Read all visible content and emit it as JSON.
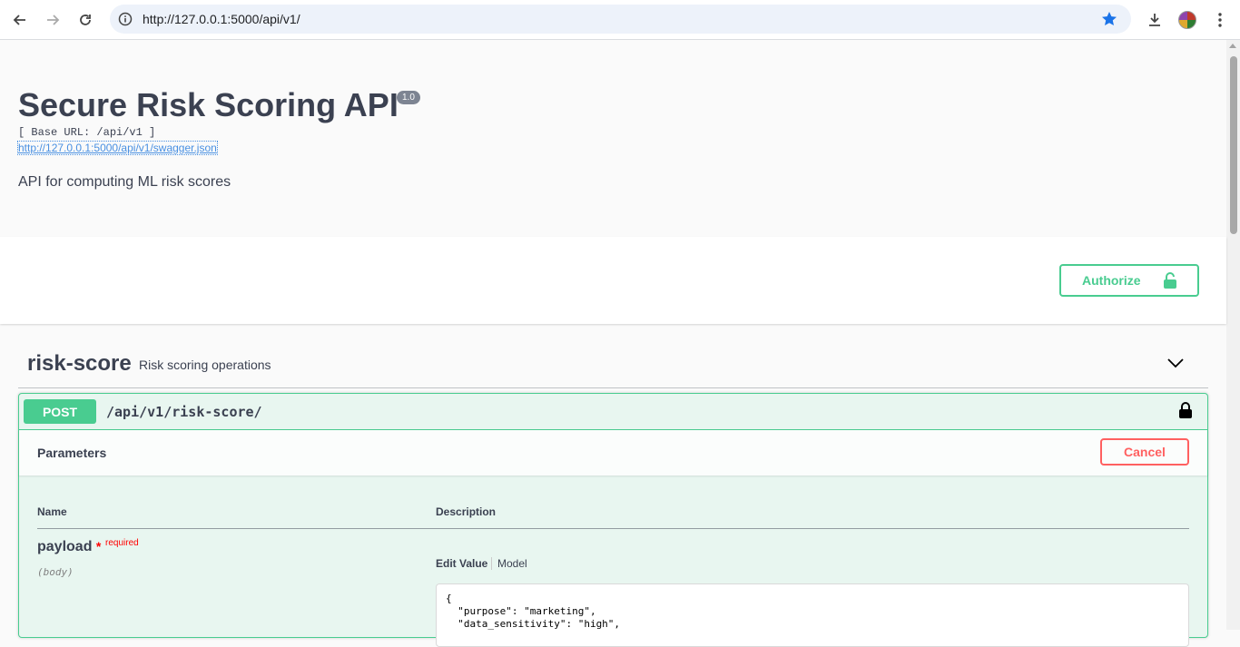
{
  "browser": {
    "url": "http://127.0.0.1:5000/api/v1/"
  },
  "info": {
    "title": "Secure Risk Scoring API",
    "version": "1.0",
    "base_url": "[ Base URL: /api/v1 ]",
    "spec_link": "http://127.0.0.1:5000/api/v1/swagger.json",
    "description": "API for computing ML risk scores"
  },
  "scheme": {
    "authorize_label": "Authorize"
  },
  "tag": {
    "name": "risk-score",
    "description": "Risk scoring operations"
  },
  "operation": {
    "method": "POST",
    "path": "/api/v1/risk-score/",
    "parameters_title": "Parameters",
    "cancel_label": "Cancel",
    "columns": {
      "name": "Name",
      "description": "Description"
    },
    "param": {
      "name": "payload",
      "required_star": "*",
      "required_label": "required",
      "location": "(body)"
    },
    "tabs": {
      "edit_value": "Edit Value",
      "model": "Model"
    },
    "body_value": "{\n  \"purpose\": \"marketing\",\n  \"data_sensitivity\": \"high\","
  },
  "colors": {
    "post_green": "#49cc90",
    "cancel_red": "#ff6060",
    "text_dark": "#3b4151"
  }
}
